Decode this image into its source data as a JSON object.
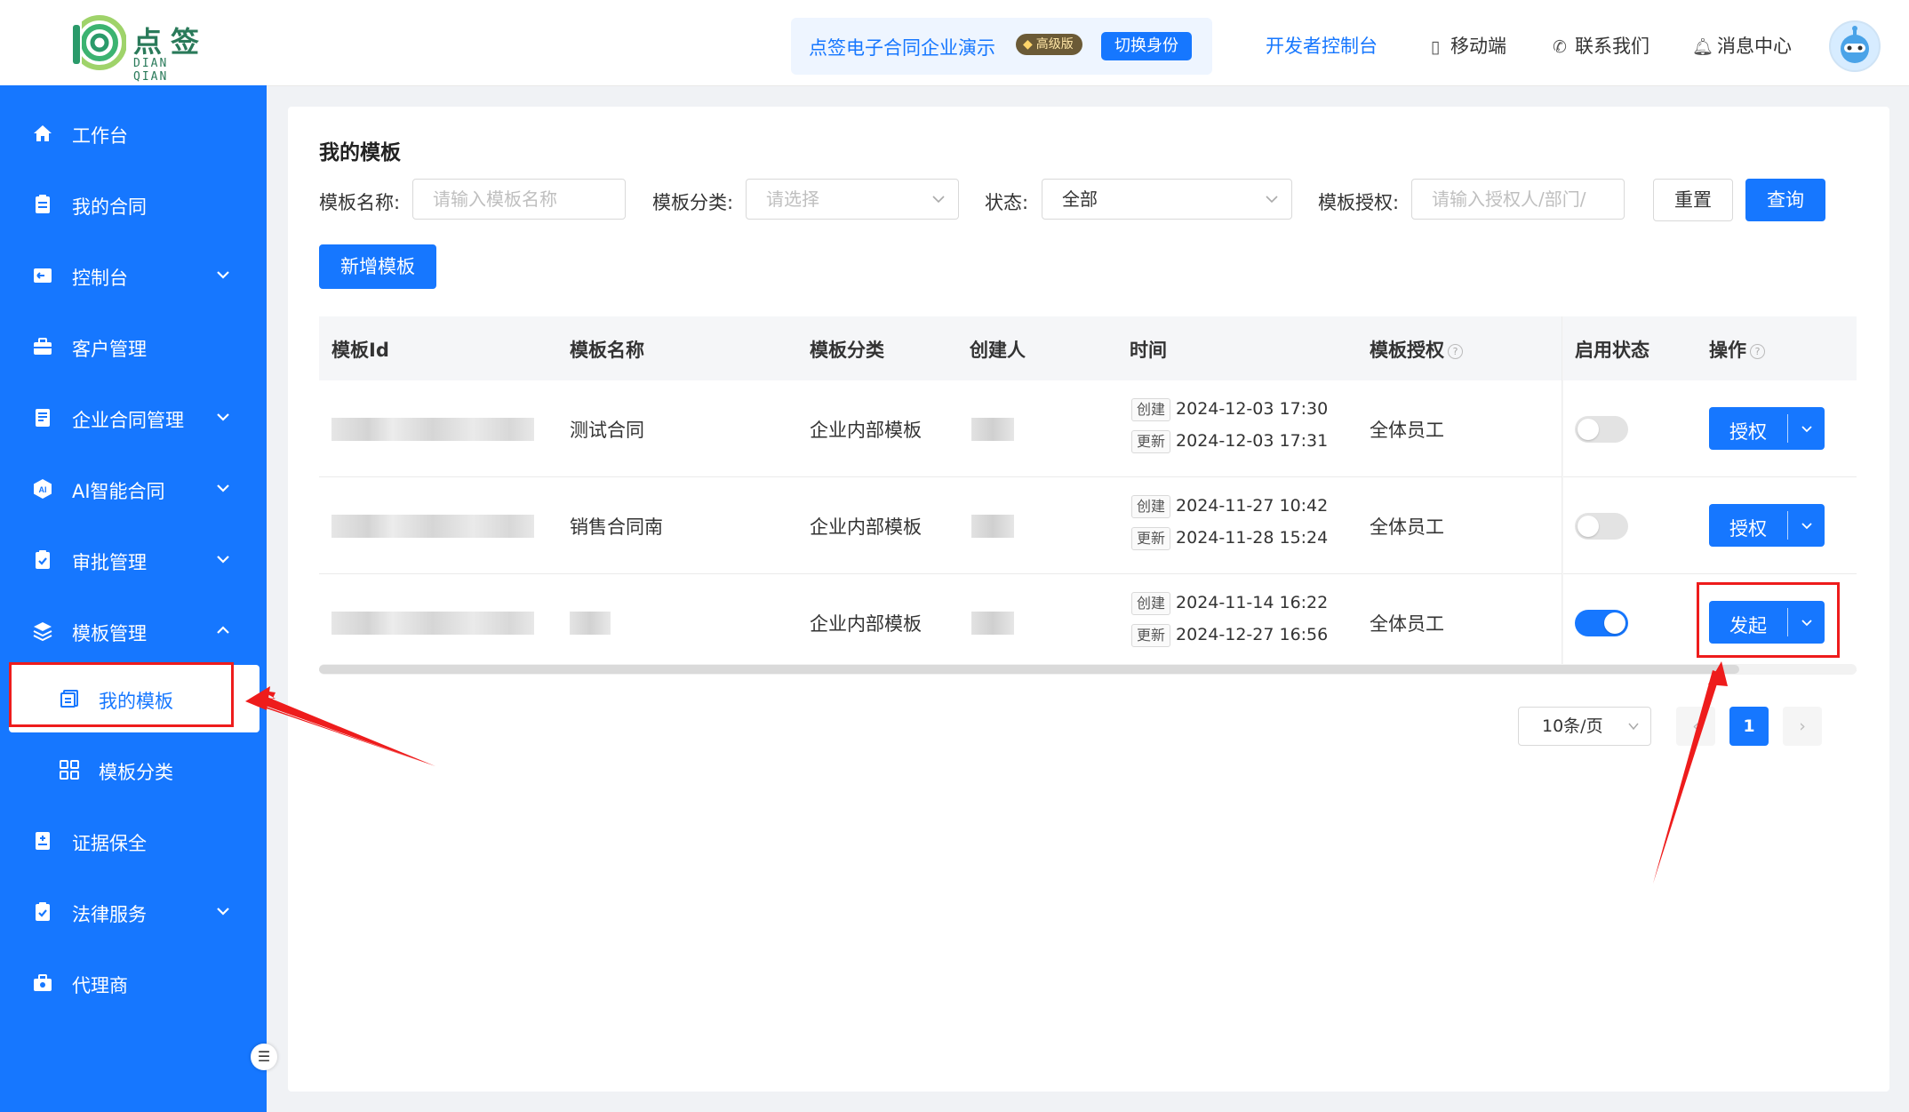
{
  "header": {
    "logo_cn": "点签",
    "logo_en": "DIAN QIAN",
    "company_name": "点签电子合同企业演示",
    "vip_badge": "高级版",
    "switch_identity": "切换身份",
    "dev_console": "开发者控制台",
    "mobile": "移动端",
    "contact": "联系我们",
    "messages": "消息中心"
  },
  "sidebar": {
    "items": [
      {
        "label": "工作台",
        "icon": "home-icon"
      },
      {
        "label": "我的合同",
        "icon": "contract-icon"
      },
      {
        "label": "控制台",
        "icon": "console-icon"
      },
      {
        "label": "客户管理",
        "icon": "briefcase-icon"
      },
      {
        "label": "企业合同管理",
        "icon": "document-icon"
      },
      {
        "label": "AI智能合同",
        "icon": "ai-icon"
      },
      {
        "label": "审批管理",
        "icon": "approval-icon"
      },
      {
        "label": "模板管理",
        "icon": "layers-icon"
      },
      {
        "label": "证据保全",
        "icon": "evidence-icon"
      },
      {
        "label": "法律服务",
        "icon": "legal-icon"
      },
      {
        "label": "代理商",
        "icon": "agent-icon"
      }
    ],
    "sub_items": [
      {
        "label": "我的模板",
        "icon": "template-icon"
      },
      {
        "label": "模板分类",
        "icon": "grid-icon"
      }
    ]
  },
  "page": {
    "title": "我的模板",
    "filters": {
      "name_label": "模板名称:",
      "name_placeholder": "请输入模板名称",
      "category_label": "模板分类:",
      "category_placeholder": "请选择",
      "status_label": "状态:",
      "status_value": "全部",
      "auth_label": "模板授权:",
      "auth_placeholder": "请输入授权人/部门/",
      "reset": "重置",
      "query": "查询"
    },
    "add_button": "新增模板"
  },
  "table": {
    "headers": {
      "id": "模板Id",
      "name": "模板名称",
      "category": "模板分类",
      "creator": "创建人",
      "time": "时间",
      "auth": "模板授权",
      "status": "启用状态",
      "action": "操作"
    },
    "tag_created": "创建",
    "tag_updated": "更新",
    "rows": [
      {
        "name": "测试合同",
        "category": "企业内部模板",
        "created": "2024-12-03 17:30",
        "updated": "2024-12-03 17:31",
        "auth": "全体员工",
        "enabled": false,
        "action": "授权"
      },
      {
        "name": "销售合同南",
        "category": "企业内部模板",
        "created": "2024-11-27 10:42",
        "updated": "2024-11-28 15:24",
        "auth": "全体员工",
        "enabled": false,
        "action": "授权"
      },
      {
        "name": "",
        "category": "企业内部模板",
        "created": "2024-11-14 16:22",
        "updated": "2024-12-27 16:56",
        "auth": "全体员工",
        "enabled": true,
        "action": "发起"
      }
    ]
  },
  "pagination": {
    "page_size": "10条/页",
    "current": "1"
  },
  "colors": {
    "primary": "#1677ff",
    "annotation": "#ee1c1c",
    "sidebar": "#1677ff"
  }
}
